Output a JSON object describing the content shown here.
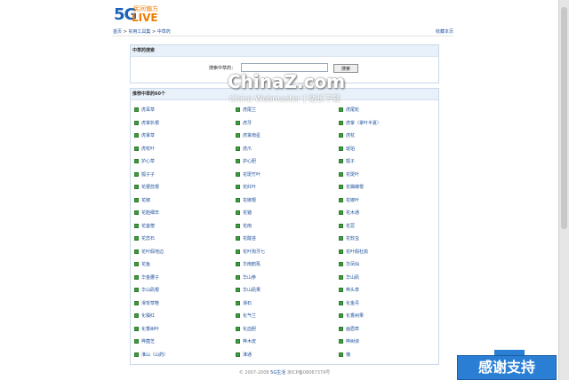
{
  "logo": {
    "mark": "5G",
    "live": "LIVE",
    "slogan": "民间偏方"
  },
  "breadcrumb": {
    "home": "首页",
    "sep1": " > ",
    "tools": "实用工具集",
    "sep2": " > ",
    "current": "中草药"
  },
  "favorite": "收藏本页",
  "search": {
    "title": "中草药搜索",
    "label": "搜索中草药：",
    "value": "",
    "button": "搜索"
  },
  "list": {
    "title": "推荐中草药60个",
    "items": [
      "虎耳草",
      "虎尾兰",
      "虎尾轮",
      "虎掌扒根",
      "虎牙",
      "虎掌（掌叶半夏）",
      "虎掌草",
      "虎掌南星",
      "虎杖",
      "虎杖叶",
      "虎爪",
      "琥珀",
      "护心草",
      "护心胆",
      "瓠子",
      "瓠子子",
      "花斑竹叶",
      "花斑叶",
      "花梗蕊根",
      "花红叶",
      "花蝴蝶根",
      "花椒",
      "花椒根",
      "花椒叶",
      "花脸细辛",
      "花锚",
      "花木通",
      "花苜蓿",
      "花南",
      "花荵",
      "花蕊石",
      "花酸苔",
      "花软虫",
      "花叶假地边",
      "花叶狗牙七",
      "花叶假杜鹃",
      "花鱼",
      "华南鹤虱",
      "华凤仙",
      "华金腰子",
      "华山参",
      "华山矾",
      "华山矾根",
      "华山矾果",
      "桦头草",
      "滑背草鞋",
      "滑石",
      "化金丹",
      "化橘红",
      "化气兰",
      "化香树果",
      "化香树叶",
      "化血胆",
      "画眉草",
      "桦菌芝",
      "桦木皮",
      "桦树液",
      "淮山（山药）",
      "淮通",
      "槐"
    ]
  },
  "watermark": {
    "brand_a": "China",
    "brand_b": "Z",
    "brand_c": ".com",
    "sub": "China Webmaster | 站长下载"
  },
  "footer": {
    "copy": "© 2007-2008 ",
    "site": "5G生活",
    "icp": " 京ICP备08067379号"
  },
  "thanks": "感谢支持",
  "colors": {
    "link": "#1d4f9a",
    "header_bg": "#e8f1fa",
    "bullet": "#3c9d3c",
    "thanks_bg": "#2a7fd4"
  }
}
